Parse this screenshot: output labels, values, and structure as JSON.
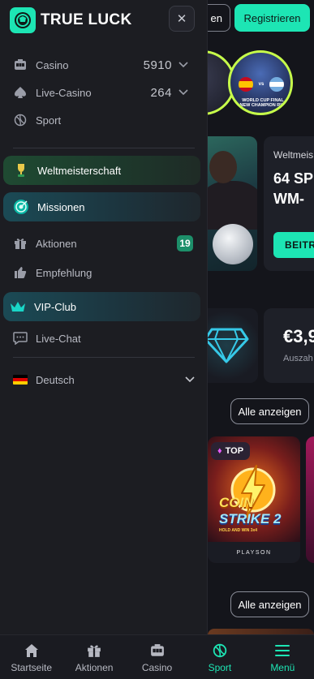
{
  "header": {
    "login_label": "en",
    "register_label": "Registrieren"
  },
  "stories": {
    "wc_caption": "WORLD CUP FINAL\nA NEW CHAMPION RISES",
    "vs": "vs"
  },
  "promo": {
    "kicker": "Weltmeis",
    "title_line1": "64 SP",
    "title_line2": "WM-",
    "button": "BEITR"
  },
  "jackpot": {
    "value": "€3,9",
    "sub": "Auszah"
  },
  "game_section": {
    "show_all_label": "Alle anzeigen",
    "badge": "TOP",
    "game_title_1": "COIN",
    "game_title_2": "STRIKE 2",
    "game_subtitle": "HOLD AND WIN 3x4",
    "provider": "PLAYSON"
  },
  "game_section_2": {
    "show_all_label": "Alle anzeigen"
  },
  "drawer": {
    "logo_text": "TRUE LUCK",
    "items": [
      {
        "label": "Casino",
        "count": "5910",
        "icon": "slot-machine-icon"
      },
      {
        "label": "Live-Casino",
        "count": "264",
        "icon": "spade-icon"
      },
      {
        "label": "Sport",
        "icon": "sport-ball-icon"
      }
    ],
    "highlights": {
      "worldcup": "Weltmeisterschaft",
      "missions": "Missionen",
      "vip": "VIP-Club"
    },
    "secondary": [
      {
        "label": "Aktionen",
        "badge": "19",
        "icon": "gift-icon"
      },
      {
        "label": "Empfehlung",
        "icon": "thumbs-up-icon"
      }
    ],
    "livechat": "Live-Chat",
    "language": "Deutsch"
  },
  "tabbar": {
    "tabs": [
      {
        "label": "Startseite",
        "icon": "home-icon"
      },
      {
        "label": "Aktionen",
        "icon": "gift-icon"
      },
      {
        "label": "Casino",
        "icon": "slot-machine-icon"
      },
      {
        "label": "Sport",
        "icon": "sport-ball-icon",
        "active": true
      },
      {
        "label": "Menü",
        "icon": "menu-icon"
      }
    ]
  },
  "colors": {
    "accent": "#1de5b4",
    "drawer_bg": "#1c1d22",
    "story_ring": "#c7ff4a"
  }
}
